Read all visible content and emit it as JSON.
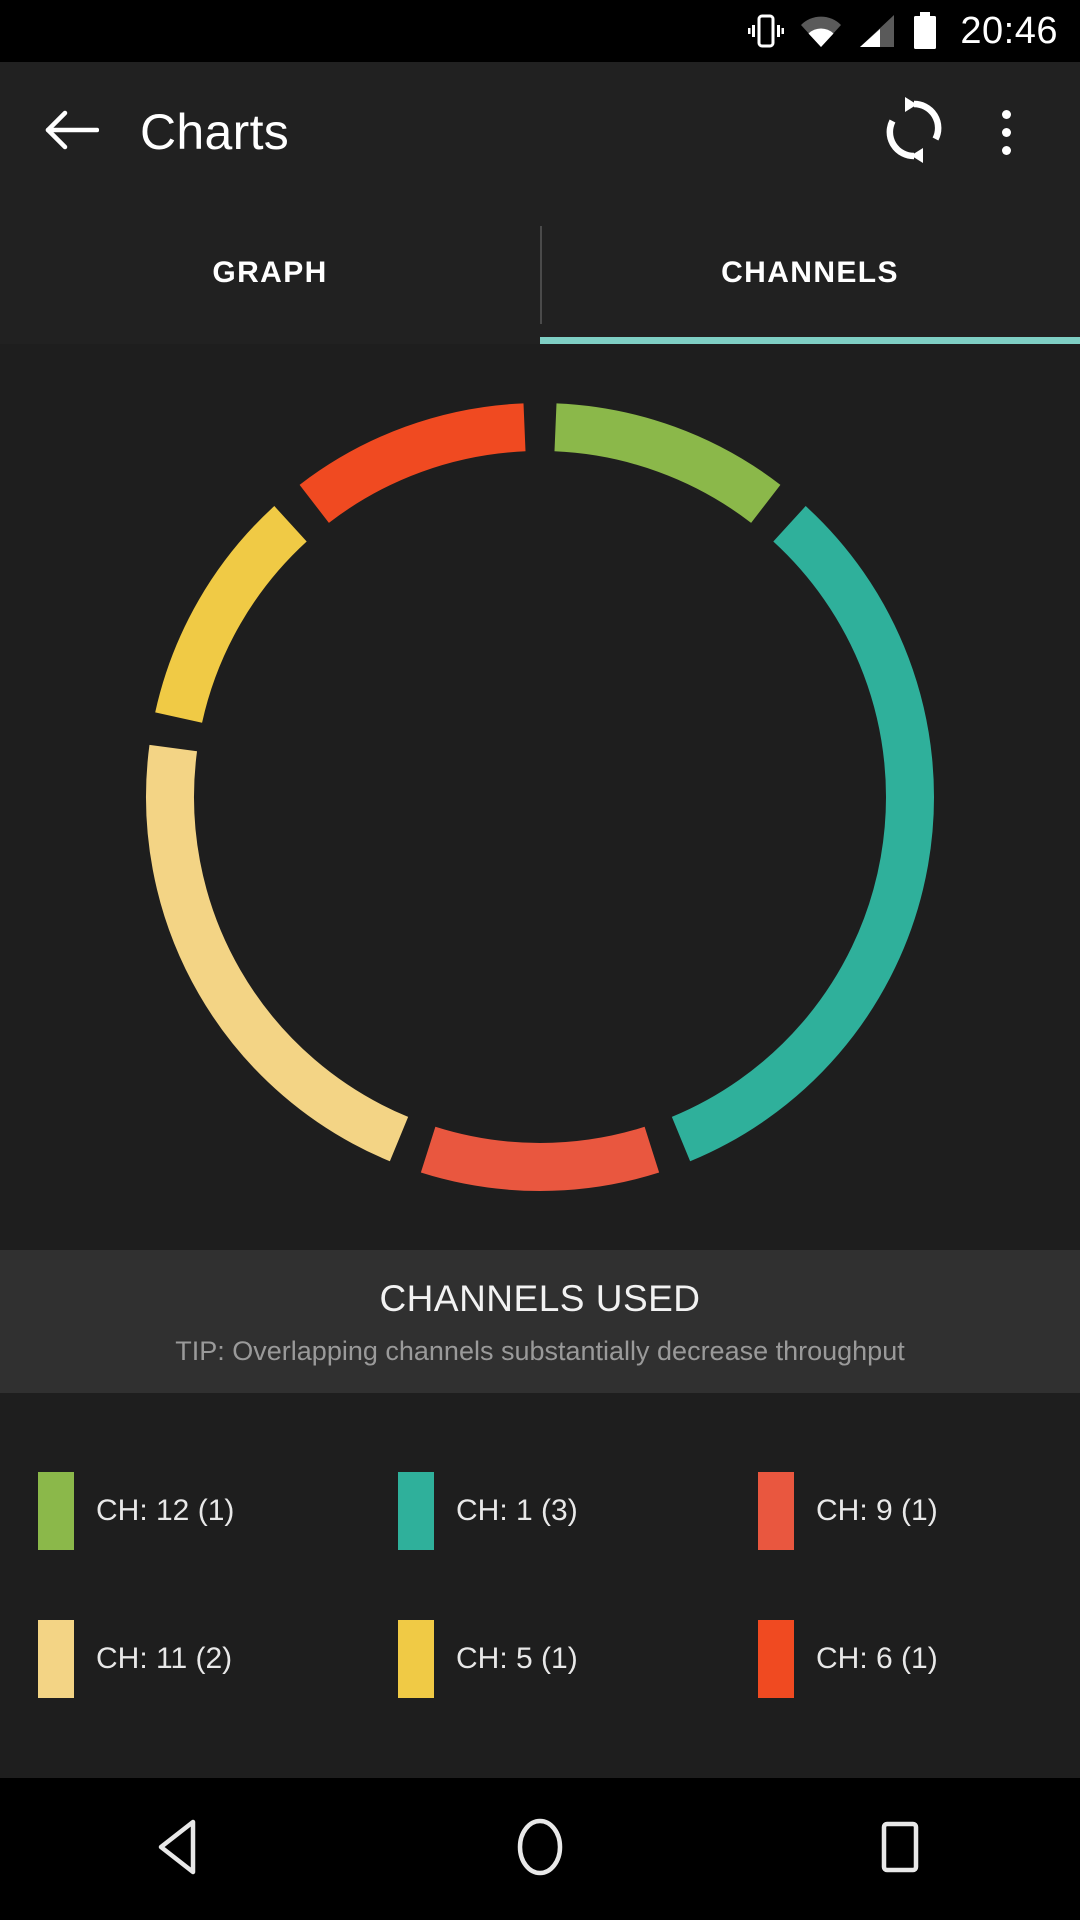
{
  "statusbar": {
    "time": "20:46",
    "icons": [
      "vibrate-icon",
      "wifi-icon",
      "cellular-signal-icon",
      "battery-icon"
    ]
  },
  "appbar": {
    "title": "Charts",
    "back_icon": "arrow-back-icon",
    "refresh_icon": "refresh-icon",
    "overflow_icon": "overflow-menu-icon"
  },
  "tabs": {
    "items": [
      {
        "label": "GRAPH",
        "active": false
      },
      {
        "label": "CHANNELS",
        "active": true
      }
    ],
    "indicator_color": "#7FCFC4"
  },
  "panel": {
    "title": "CHANNELS USED",
    "tip": "TIP: Overlapping channels substantially decrease throughput"
  },
  "legend": {
    "rows": [
      [
        {
          "label": "CH: 12 (1)",
          "color": "#8BB84A"
        },
        {
          "label": "CH: 1 (3)",
          "color": "#2FB09B"
        },
        {
          "label": "CH: 9 (1)",
          "color": "#E9573F"
        }
      ],
      [
        {
          "label": "CH: 11 (2)",
          "color": "#F3D485"
        },
        {
          "label": "CH: 5 (1)",
          "color": "#F0CA45"
        },
        {
          "label": "CH: 6 (1)",
          "color": "#F04A21"
        }
      ]
    ]
  },
  "navbar": {
    "back_icon": "nav-back-triangle-icon",
    "home_icon": "nav-home-circle-icon",
    "recents_icon": "nav-recents-square-icon"
  },
  "chart_data": {
    "type": "pie",
    "title": "CHANNELS USED",
    "subtitle": "TIP: Overlapping channels substantially decrease throughput",
    "variant": "donut",
    "start_angle_deg": 0,
    "direction": "clockwise",
    "labels": [
      "CH: 12 (1)",
      "CH: 1 (3)",
      "CH: 9 (1)",
      "CH: 11 (2)",
      "CH: 5 (1)",
      "CH: 6 (1)"
    ],
    "channels": [
      12,
      1,
      9,
      11,
      5,
      6
    ],
    "values": [
      1,
      3,
      1,
      2,
      1,
      1
    ],
    "total": 9,
    "percentages": [
      11.1,
      33.3,
      11.1,
      22.2,
      11.1,
      11.1
    ],
    "colors": [
      "#8BB84A",
      "#2FB09B",
      "#E9573F",
      "#F3D485",
      "#F0CA45",
      "#F04A21"
    ],
    "legend_position": "bottom",
    "grid": false
  }
}
